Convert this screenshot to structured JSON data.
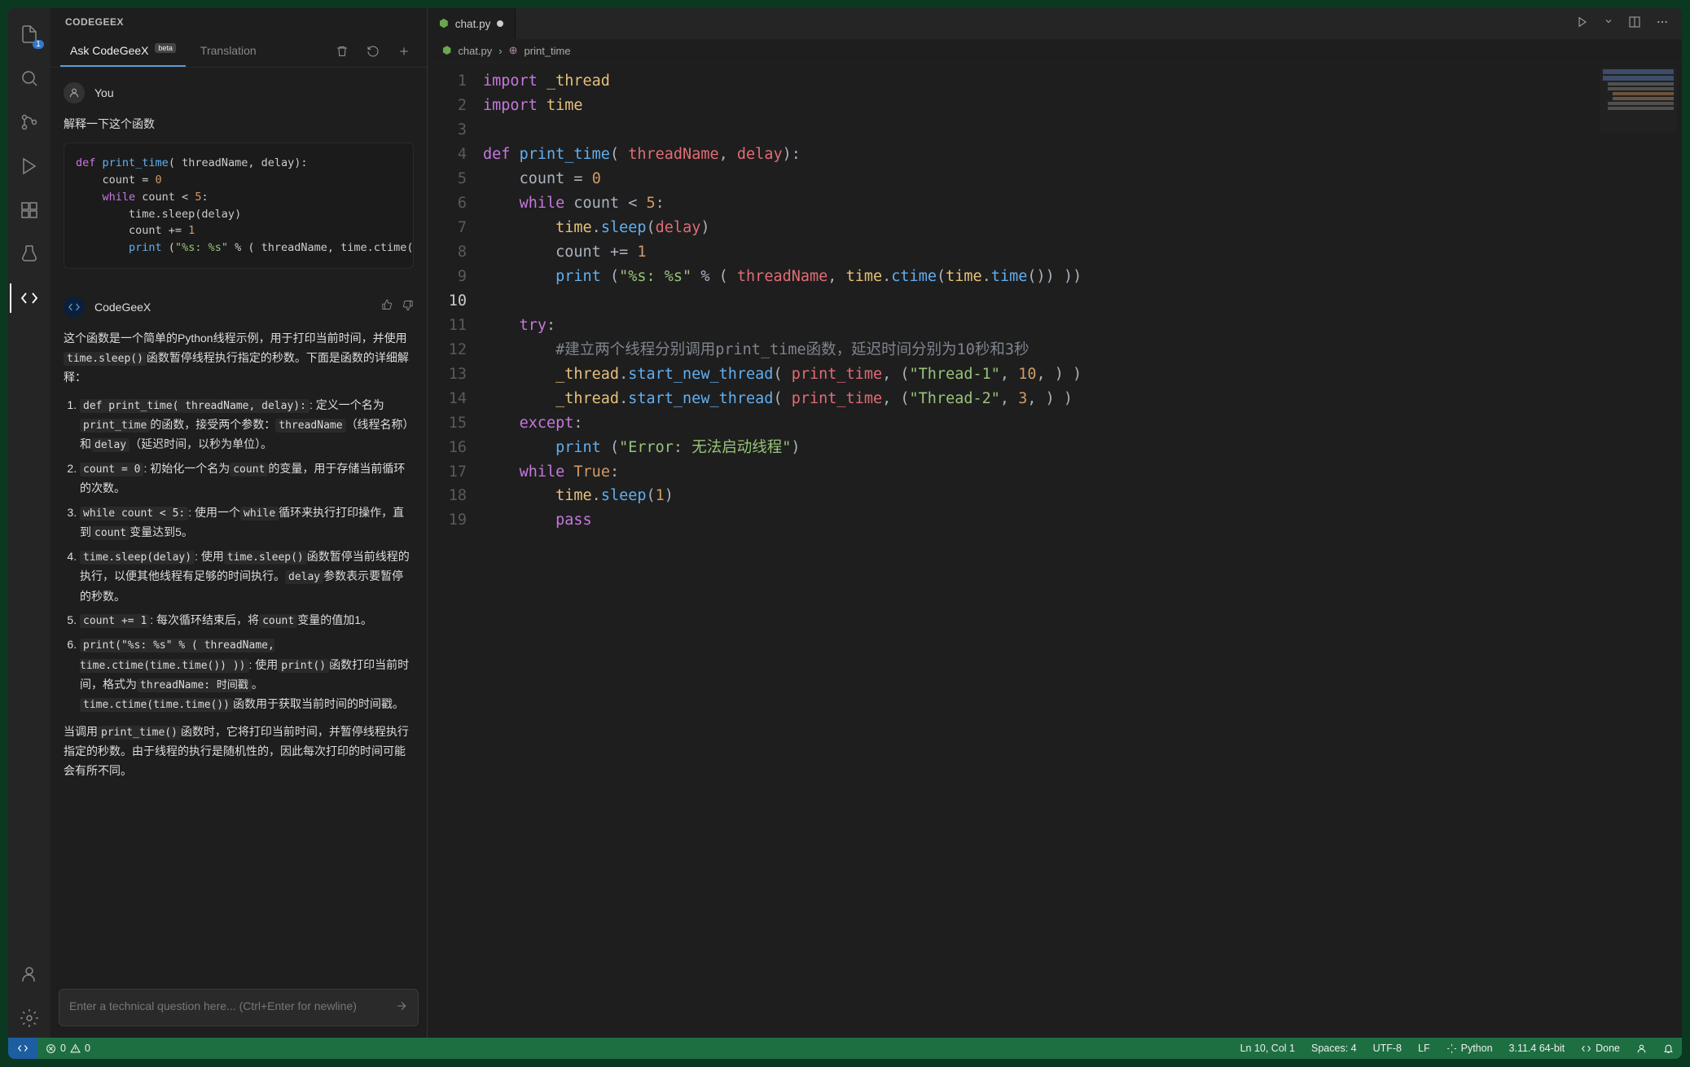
{
  "sidebar": {
    "title": "CODEGEEX",
    "tabs": {
      "ask": "Ask CodeGeeX",
      "beta": "beta",
      "translation": "Translation"
    },
    "explorer_badge": "1"
  },
  "chat": {
    "user_name": "You",
    "user_prompt": "解释一下这个函数",
    "user_code": "def print_time( threadName, delay):\n    count = 0\n    while count < 5:\n        time.sleep(delay)\n        count += 1\n        print (\"%s: %s\" % ( threadName, time.ctime(time.ti",
    "bot_name": "CodeGeeX",
    "reply_intro": "这个函数是一个简单的Python线程示例，用于打印当前时间，并使用",
    "reply_intro_code": "time.sleep()",
    "reply_intro2": "函数暂停线程执行指定的秒数。下面是函数的详细解释：",
    "items": {
      "i1a": "def print_time( threadName, delay):",
      "i1b": ": 定义一个名为",
      "i1c": "print_time",
      "i1d": "的函数，接受两个参数：",
      "i1e": "threadName",
      "i1f": "（线程名称）和",
      "i1g": "delay",
      "i1h": "（延迟时间，以秒为单位）。",
      "i2a": "count = 0",
      "i2b": ": 初始化一个名为",
      "i2c": "count",
      "i2d": "的变量，用于存储当前循环的次数。",
      "i3a": "while count < 5:",
      "i3b": ": 使用一个",
      "i3c": "while",
      "i3d": "循环来执行打印操作，直到",
      "i3e": "count",
      "i3f": "变量达到5。",
      "i4a": "time.sleep(delay)",
      "i4b": ": 使用",
      "i4c": "time.sleep()",
      "i4d": "函数暂停当前线程的执行，以便其他线程有足够的时间执行。",
      "i4e": "delay",
      "i4f": "参数表示要暂停的秒数。",
      "i5a": "count += 1",
      "i5b": ": 每次循环结束后，将",
      "i5c": "count",
      "i5d": "变量的值加1。",
      "i6a": "print(\"%s: %s\" % ( threadName, time.ctime(time.time()) ))",
      "i6b": ": 使用",
      "i6c": "print()",
      "i6d": "函数打印当前时间，格式为",
      "i6e": "threadName: 时间戳",
      "i6f": "。",
      "i6g": "time.ctime(time.time())",
      "i6h": "函数用于获取当前时间的时间戳。"
    },
    "reply_outro1": "当调用",
    "reply_outro_code": "print_time()",
    "reply_outro2": "函数时，它将打印当前时间，并暂停线程执行指定的秒数。由于线程的执行是随机性的，因此每次打印的时间可能会有所不同。",
    "input_placeholder": "Enter a technical question here... (Ctrl+Enter for newline)"
  },
  "editor": {
    "tab_name": "chat.py",
    "breadcrumb_file": "chat.py",
    "breadcrumb_fn": "print_time",
    "line_count": 19,
    "active_line": 10,
    "lines": {
      "l1": "import _thread",
      "l2": "import time",
      "l3": "",
      "l4": "def print_time( threadName, delay):",
      "l5": "    count = 0",
      "l6": "    while count < 5:",
      "l7": "        time.sleep(delay)",
      "l8": "        count += 1",
      "l9": "        print (\"%s: %s\" % ( threadName, time.ctime(time.time()) ))",
      "l10": "",
      "l11": "    try:",
      "l12": "        #建立两个线程分别调用print_time函数，延迟时间分别为10秒和3秒",
      "l13": "        _thread.start_new_thread( print_time, (\"Thread-1\", 10, ) )",
      "l14": "        _thread.start_new_thread( print_time, (\"Thread-2\", 3, ) )",
      "l15": "    except:",
      "l16": "        print (\"Error: 无法启动线程\")",
      "l17": "    while True:",
      "l18": "        time.sleep(1)",
      "l19": "        pass"
    }
  },
  "status": {
    "errors": "0",
    "warnings": "0",
    "position": "Ln 10, Col 1",
    "spaces": "Spaces: 4",
    "encoding": "UTF-8",
    "eol": "LF",
    "language": "Python",
    "interpreter": "3.11.4 64-bit",
    "done": "Done"
  }
}
